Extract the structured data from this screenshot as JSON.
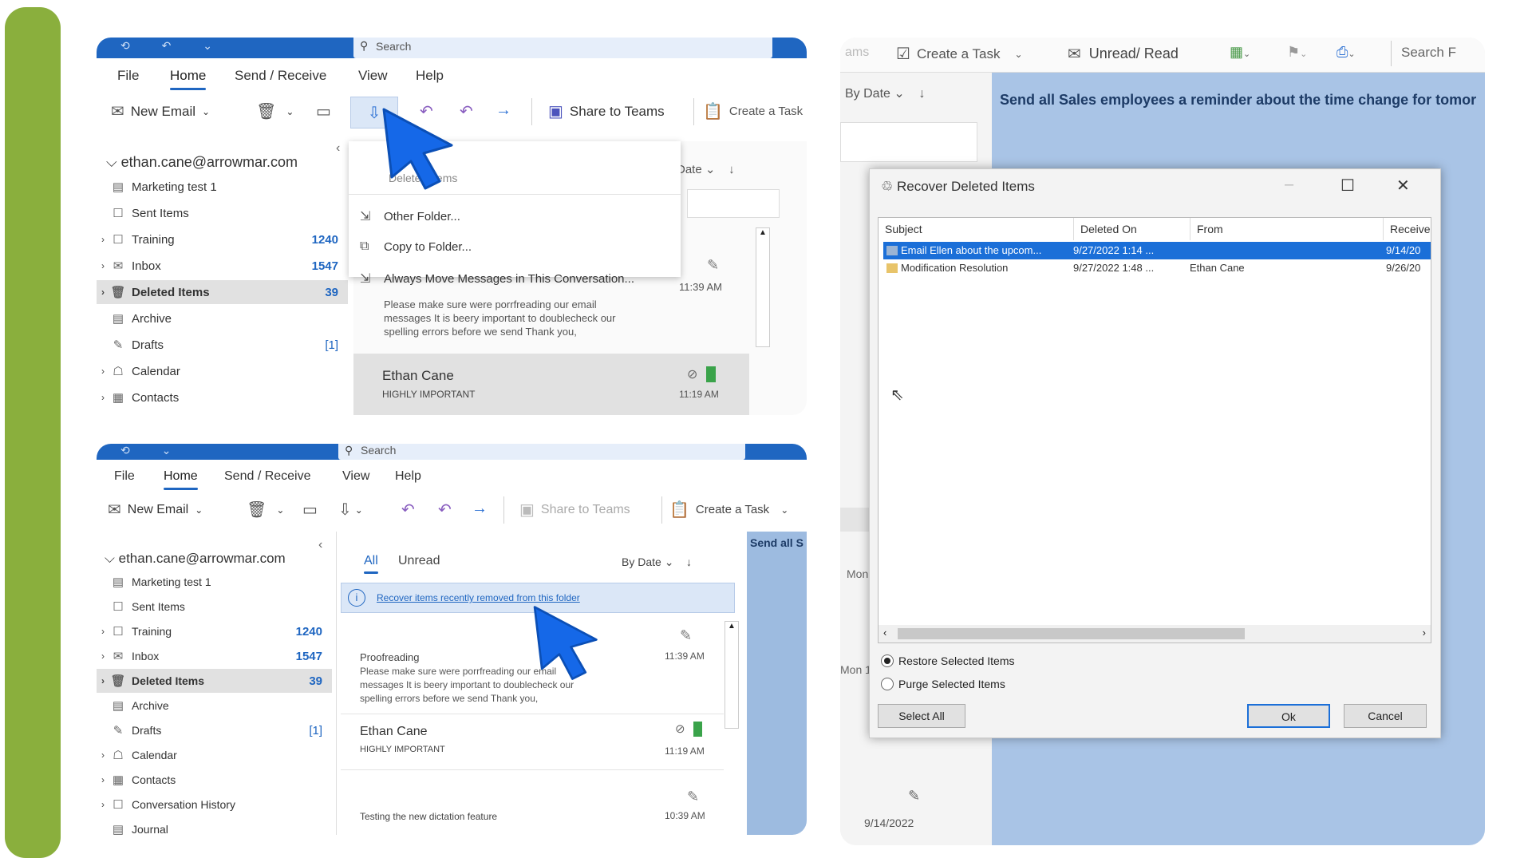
{
  "top_panel": {
    "search_placeholder": "Search",
    "menus": [
      "File",
      "Home",
      "Send / Receive",
      "View",
      "Help"
    ],
    "ribbon": {
      "new_email": "New Email",
      "share_to_teams": "Share to Teams",
      "create_task": "Create a Task"
    },
    "account": "ethan.cane@arrowmar.com",
    "folders": [
      {
        "label": "Marketing test 1",
        "count": ""
      },
      {
        "label": "Sent Items",
        "count": ""
      },
      {
        "label": "Training",
        "count": "1240"
      },
      {
        "label": "Inbox",
        "count": "1547"
      },
      {
        "label": "Deleted Items",
        "count": "39"
      },
      {
        "label": "Archive",
        "count": ""
      },
      {
        "label": "Drafts",
        "count": "[1]"
      },
      {
        "label": "Calendar",
        "count": ""
      },
      {
        "label": "Contacts",
        "count": ""
      }
    ],
    "move_menu": {
      "header": "Deleted Items",
      "items": [
        "Other Folder...",
        "Copy to Folder...",
        "Always Move Messages in This Conversation..."
      ]
    },
    "sort_label": "Date",
    "message_preview": {
      "time": "11:39 AM",
      "body": "Please make sure were porrfreading our email messages  It is beery important to doublecheck our spelling errors before we send   Thank you,"
    },
    "message2": {
      "sender": "Ethan Cane",
      "subject": "HIGHLY IMPORTANT",
      "time": "11:19 AM"
    }
  },
  "bottom_panel": {
    "search_placeholder": "Search",
    "menus": [
      "File",
      "Home",
      "Send / Receive",
      "View",
      "Help"
    ],
    "ribbon": {
      "new_email": "New Email",
      "share_to_teams": "Share to Teams",
      "create_task": "Create a Task"
    },
    "account": "ethan.cane@arrowmar.com",
    "folders": [
      {
        "label": "Marketing test 1",
        "count": ""
      },
      {
        "label": "Sent Items",
        "count": ""
      },
      {
        "label": "Training",
        "count": "1240"
      },
      {
        "label": "Inbox",
        "count": "1547"
      },
      {
        "label": "Deleted Items",
        "count": "39"
      },
      {
        "label": "Archive",
        "count": ""
      },
      {
        "label": "Drafts",
        "count": "[1]"
      },
      {
        "label": "Calendar",
        "count": ""
      },
      {
        "label": "Contacts",
        "count": ""
      },
      {
        "label": "Conversation History",
        "count": ""
      },
      {
        "label": "Journal",
        "count": ""
      }
    ],
    "tabs": {
      "all": "All",
      "unread": "Unread"
    },
    "sort_label": "By Date",
    "recover_link": "Recover items recently removed from this folder",
    "reading_pane_snippet": "Send all S",
    "messages": [
      {
        "sender": "Proofreading",
        "body": "Please make sure were porrfreading our email messages  It is beery important to doublecheck our spelling errors before we send   Thank you,",
        "time": "11:39 AM"
      },
      {
        "sender": "Ethan Cane",
        "body": "HIGHLY IMPORTANT",
        "time": "11:19 AM"
      },
      {
        "sender": "Testing the new dictation feature",
        "body": "",
        "time": "10:39 AM"
      }
    ]
  },
  "right_panel": {
    "ribbon": {
      "frag": "ams",
      "create_task": "Create a Task",
      "unread_read": "Unread/ Read",
      "search": "Search F"
    },
    "sort_label": "By Date",
    "reading_subject": "Send all Sales employees a reminder about the time change for tomor",
    "side_labels": [
      "Mon",
      "Mon 1"
    ],
    "date_bottom": "9/14/2022",
    "dialog": {
      "title": "Recover Deleted Items",
      "columns": [
        "Subject",
        "Deleted On",
        "From",
        "Receive"
      ],
      "rows": [
        {
          "subject": "Email Ellen about the upcom...",
          "deleted_on": "9/27/2022 1:14 ...",
          "from": "",
          "received": "9/14/20",
          "selected": true
        },
        {
          "subject": "Modification Resolution",
          "deleted_on": "9/27/2022 1:48 ...",
          "from": "Ethan Cane",
          "received": "9/26/20",
          "selected": false
        }
      ],
      "restore_label": "Restore Selected Items",
      "purge_label": "Purge Selected Items",
      "select_all": "Select All",
      "ok": "Ok",
      "cancel": "Cancel"
    }
  }
}
